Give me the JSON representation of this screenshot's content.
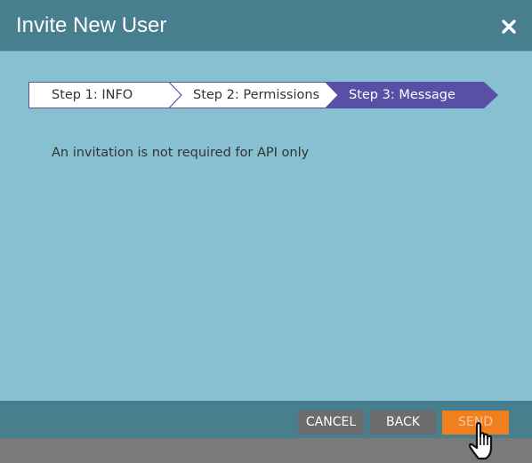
{
  "dialog": {
    "title": "Invite New User",
    "close_icon": "close-icon"
  },
  "wizard": {
    "steps": [
      {
        "label": "Step 1: INFO",
        "active": false
      },
      {
        "label": "Step 2: Permissions",
        "active": false
      },
      {
        "label": "Step 3: Message",
        "active": true
      }
    ],
    "colors": {
      "inactive_bg": "#ffffff",
      "active_bg": "#5a4fa6",
      "border": "#5a4fa6"
    }
  },
  "content": {
    "message": "An invitation is not required for API only"
  },
  "footer": {
    "cancel_label": "CANCEL",
    "back_label": "BACK",
    "send_label": "SEND"
  },
  "colors": {
    "titlebar": "#477f8f",
    "body": "#86c0d1",
    "send_button": "#f07f20",
    "secondary_button": "#6c6c6c"
  },
  "cursor_icon": "hand-pointer-icon"
}
